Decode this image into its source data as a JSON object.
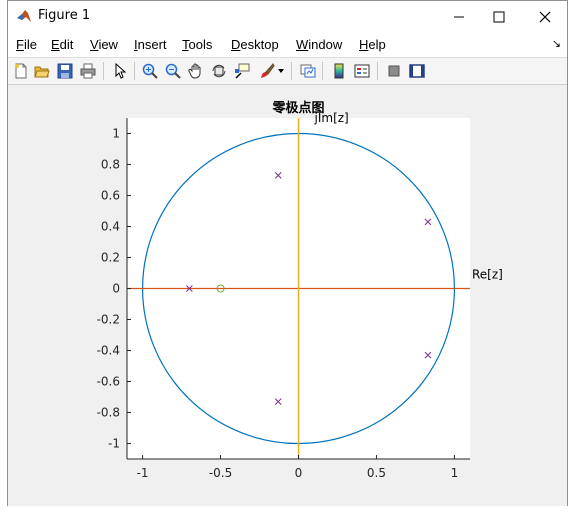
{
  "window": {
    "title": "Figure 1"
  },
  "menu": {
    "items": [
      {
        "ul": "F",
        "rest": "ile"
      },
      {
        "ul": "E",
        "rest": "dit"
      },
      {
        "ul": "V",
        "rest": "iew"
      },
      {
        "ul": "I",
        "rest": "nsert"
      },
      {
        "ul": "T",
        "rest": "ools"
      },
      {
        "ul": "D",
        "rest": "esktop"
      },
      {
        "ul": "W",
        "rest": "indow"
      },
      {
        "ul": "H",
        "rest": "elp"
      }
    ]
  },
  "toolbar": {
    "icons": [
      "new-figure-icon",
      "open-file-icon",
      "save-icon",
      "print-icon",
      "pointer-icon",
      "zoom-in-icon",
      "zoom-out-icon",
      "pan-icon",
      "rotate-3d-icon",
      "data-cursor-icon",
      "brush-icon",
      "brush-dropdown-icon",
      "link-plot-icon",
      "colorbar-icon",
      "legend-icon",
      "hide-plot-tools-icon",
      "show-plot-tools-icon"
    ]
  },
  "chart_data": {
    "type": "scatter",
    "title": "零极点图",
    "xlabel_annotation": "Re[z]",
    "ylabel_annotation": "jIm[z]",
    "xlim": [
      -1.1,
      1.1
    ],
    "ylim": [
      -1.1,
      1.1
    ],
    "xticks": [
      -1,
      -0.5,
      0,
      0.5,
      1
    ],
    "xtick_labels": [
      "-1",
      "-0.5",
      "0",
      "0.5",
      "1"
    ],
    "yticks": [
      1,
      0.8,
      0.6,
      0.4,
      0.2,
      0,
      -0.2,
      -0.4,
      -0.6,
      -0.8,
      -1
    ],
    "ytick_labels": [
      "1",
      "0.8",
      "0.6",
      "0.4",
      "0.2",
      "0",
      "-0.2",
      "-0.4",
      "-0.6",
      "-0.8",
      "-1"
    ],
    "unit_circle": {
      "radius": 1,
      "color": "#0072BD"
    },
    "real_axis_color": "#D95319",
    "imag_axis_color": "#EDB120",
    "poles": {
      "marker": "x",
      "color": "#7E2F8E",
      "points": [
        [
          -0.7,
          0
        ],
        [
          -0.13,
          0.73
        ],
        [
          -0.13,
          -0.73
        ],
        [
          0.83,
          0.43
        ],
        [
          0.83,
          -0.43
        ]
      ]
    },
    "zeros": {
      "marker": "o",
      "color": "#77AC30",
      "points": [
        [
          -0.5,
          0
        ]
      ]
    }
  }
}
